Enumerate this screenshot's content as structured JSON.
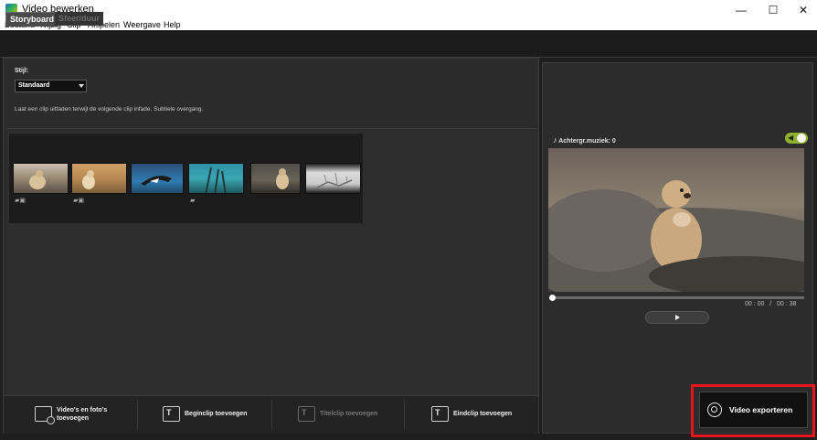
{
  "window": {
    "title": "Video bewerken",
    "controls": [
      "—",
      "☐",
      "✕"
    ]
  },
  "menu": [
    "Bestand",
    "Wijzig",
    "Clip",
    "Afspelen",
    "Weergave",
    "Help"
  ],
  "tabs": [
    {
      "label": "Storyboard",
      "active": true
    },
    {
      "label": "Sfeer/duur",
      "active": false
    }
  ],
  "style": {
    "label": "Stijl:",
    "selected": "Standaard",
    "description": "Laat een clip uitfaden terwijl de volgende clip infade. Subtiele overgang."
  },
  "clips": [
    {
      "kind": "video+photo",
      "icons": "▰▣"
    },
    {
      "kind": "video+photo",
      "icons": "▰▣"
    },
    {
      "kind": "photo",
      "icons": ""
    },
    {
      "kind": "video",
      "icons": "▰"
    },
    {
      "kind": "photo",
      "icons": ""
    },
    {
      "kind": "photo",
      "icons": ""
    }
  ],
  "toolbar": {
    "add_media": "Video's en foto's toevoegen",
    "add_start": "Beginclip toevoegen",
    "add_title": "Titelclip toevoegen",
    "add_end": "Eindclip toevoegen"
  },
  "preview": {
    "music_label": "Achtergr.muziek: 0",
    "music_enabled": true,
    "time": "00 : 00   /   00 : 38",
    "playback_progress": 0
  },
  "export": {
    "label": "Video exporteren"
  },
  "colors": {
    "accent_green": "#90b030",
    "highlight_red": "#e8141b",
    "panel": "#2b2b2b"
  }
}
